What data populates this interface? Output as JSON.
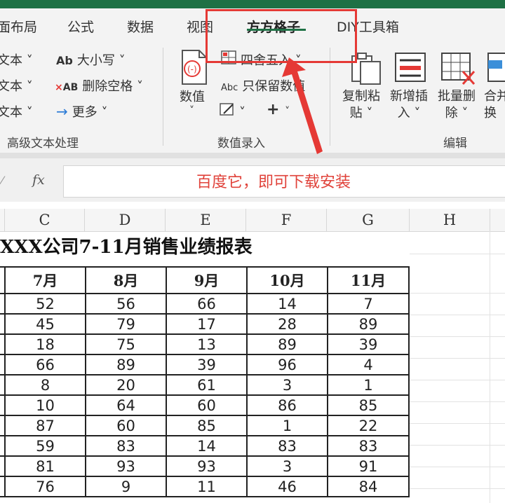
{
  "tabs": [
    "面布局",
    "公式",
    "数据",
    "视图",
    "方方格子",
    "DIY工具箱"
  ],
  "active_tab": "方方格子",
  "ribbon": {
    "text_group": {
      "rows_left": [
        "文本 ˅",
        "文本 ˅",
        "文本 ˅"
      ],
      "case_label": "大小写 ˅",
      "case_icon": "Ab",
      "delete_space_label": "删除空格 ˅",
      "delete_space_icon": "AB",
      "more_label": "更多 ˅",
      "group_label": "高级文本处理"
    },
    "value_group": {
      "numeric_label": "数值",
      "round_label": "四舍五入 ˅",
      "keep_value_label": "只保留数值",
      "keep_value_icon": "Abc",
      "plus_icon": "+",
      "group_label": "数值录入"
    },
    "edit_group": {
      "copy_paste_line1": "复制粘",
      "copy_paste_line2": "贴 ˅",
      "insert_line1": "新增插",
      "insert_line2": "入 ˅",
      "batch_delete_line1": "批量删",
      "batch_delete_line2": "除 ˅",
      "merge_line1": "合并",
      "merge_line2": "换",
      "group_label": "编辑"
    }
  },
  "formula_bar": {
    "fx_label": "fx",
    "value": "百度它，即可下载安装"
  },
  "columns": [
    "C",
    "D",
    "E",
    "F",
    "G",
    "H"
  ],
  "sheet": {
    "title": "XXX公司7-11月销售业绩报表",
    "headers": [
      "7月",
      "8月",
      "9月",
      "10月",
      "11月"
    ],
    "rows": [
      [
        52,
        56,
        66,
        14,
        7
      ],
      [
        45,
        79,
        17,
        28,
        89
      ],
      [
        18,
        75,
        13,
        89,
        39
      ],
      [
        66,
        89,
        39,
        96,
        4
      ],
      [
        8,
        20,
        61,
        3,
        1
      ],
      [
        10,
        64,
        60,
        86,
        85
      ],
      [
        87,
        60,
        85,
        1,
        22
      ],
      [
        59,
        83,
        14,
        83,
        83
      ],
      [
        81,
        93,
        93,
        3,
        91
      ],
      [
        76,
        9,
        11,
        46,
        84
      ]
    ]
  },
  "colors": {
    "accent": "#1e7145",
    "highlight": "#e53935",
    "formula_text": "#e0423a"
  }
}
